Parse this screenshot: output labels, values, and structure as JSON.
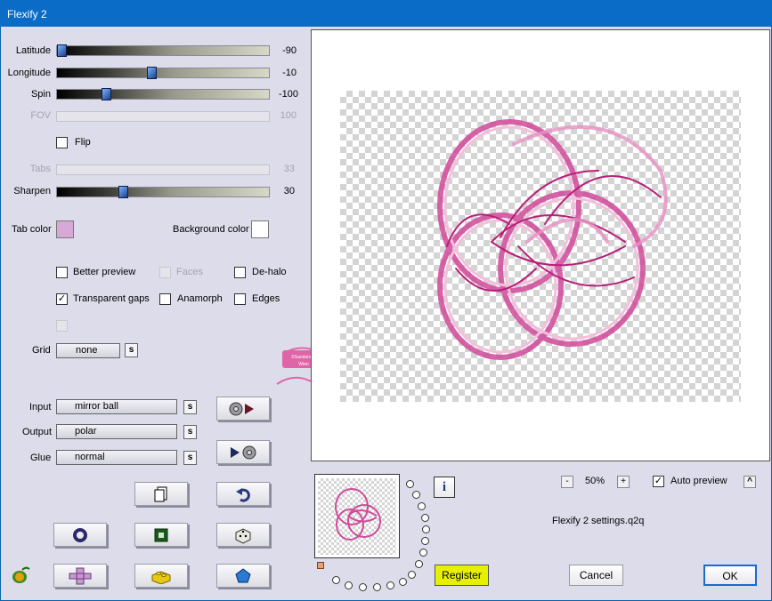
{
  "window": {
    "title": "Flexify 2"
  },
  "sliders": [
    {
      "label": "Latitude",
      "value": "-90",
      "level": 0.0,
      "enabled": true
    },
    {
      "label": "Longitude",
      "value": "-10",
      "level": 0.44,
      "enabled": true
    },
    {
      "label": "Spin",
      "value": "-100",
      "level": 0.22,
      "enabled": true
    },
    {
      "label": "FOV",
      "value": "100",
      "level": 0.0,
      "enabled": false
    },
    {
      "label": "Tabs",
      "value": "33",
      "level": 0.0,
      "enabled": false
    },
    {
      "label": "Sharpen",
      "value": "30",
      "level": 0.3,
      "enabled": true
    }
  ],
  "flip": {
    "label": "Flip",
    "checked": false
  },
  "colors": {
    "tab_color_label": "Tab color",
    "tab_color": "#d8a8d8",
    "background_color_label": "Background color",
    "background_color": "#ffffff"
  },
  "options": {
    "better_preview": {
      "label": "Better preview",
      "checked": false
    },
    "faces": {
      "label": "Faces",
      "checked": false
    },
    "de_halo": {
      "label": "De-halo",
      "checked": false
    },
    "transparent_gaps": {
      "label": "Transparent gaps",
      "checked": true
    },
    "anamorph": {
      "label": "Anamorph",
      "checked": false
    },
    "edges": {
      "label": "Edges",
      "checked": false
    }
  },
  "grid": {
    "label": "Grid",
    "value": "none",
    "s": "s"
  },
  "io": {
    "input_label": "Input",
    "input_value": "mirror ball",
    "output_label": "Output",
    "output_value": "polar",
    "glue_label": "Glue",
    "glue_value": "normal",
    "s": "s"
  },
  "zoom": {
    "minus": "-",
    "value": "50%",
    "plus": "+"
  },
  "auto_preview": {
    "label": "Auto preview",
    "checked": true,
    "up": "^"
  },
  "settings_file": "Flexify 2 settings.q2q",
  "info_icon": "i",
  "buttons": {
    "register": "Register",
    "cancel": "Cancel",
    "ok": "OK"
  },
  "watermark": "©Sandariam Wien",
  "icons": [
    "sphere-to-play-icon",
    "play-to-sphere-icon",
    "copy-icon",
    "undo-icon",
    "ring-icon",
    "square-frame-icon",
    "dice-icon",
    "plus-tab-icon",
    "puzzle-brick-icon",
    "pentagon-icon",
    "pepper-logo-icon"
  ]
}
